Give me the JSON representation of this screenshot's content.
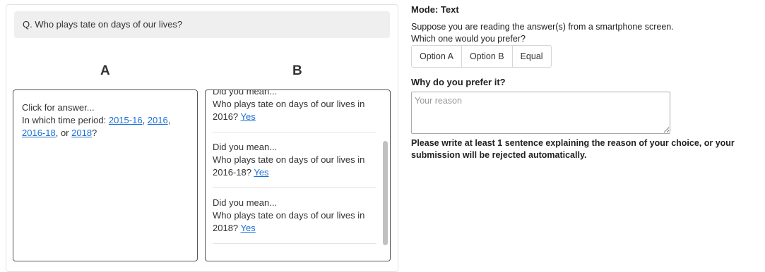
{
  "question": "Q. Who plays tate on days of our lives?",
  "column_a": {
    "header": "A",
    "click_text": "Click for answer...",
    "prompt": "In which time period: ",
    "options": [
      "2015-16",
      "2016",
      "2016-18",
      "2018"
    ],
    "sep1": ", ",
    "sep2": ", ",
    "sep3": ", or ",
    "end": "?"
  },
  "column_b": {
    "header": "B",
    "entries": [
      {
        "title": "Did you mean...",
        "text": "Who plays tate on days of our lives in 2016?",
        "link": "Yes"
      },
      {
        "title": "Did you mean...",
        "text": "Who plays tate on days of our lives in 2016-18?",
        "link": "Yes"
      },
      {
        "title": "Did you mean...",
        "text": "Who plays tate on days of our lives in 2018?",
        "link": "Yes"
      }
    ]
  },
  "right": {
    "mode": "Mode: Text",
    "instruction1": "Suppose you are reading the answer(s) from a smartphone screen.",
    "instruction2": "Which one would you prefer?",
    "buttons": [
      "Option A",
      "Option B",
      "Equal"
    ],
    "why_label": "Why do you prefer it?",
    "reason_placeholder": "Your reason",
    "warning": "Please write at least 1 sentence explaining the reason of your choice, or your submission will be rejected automatically."
  }
}
